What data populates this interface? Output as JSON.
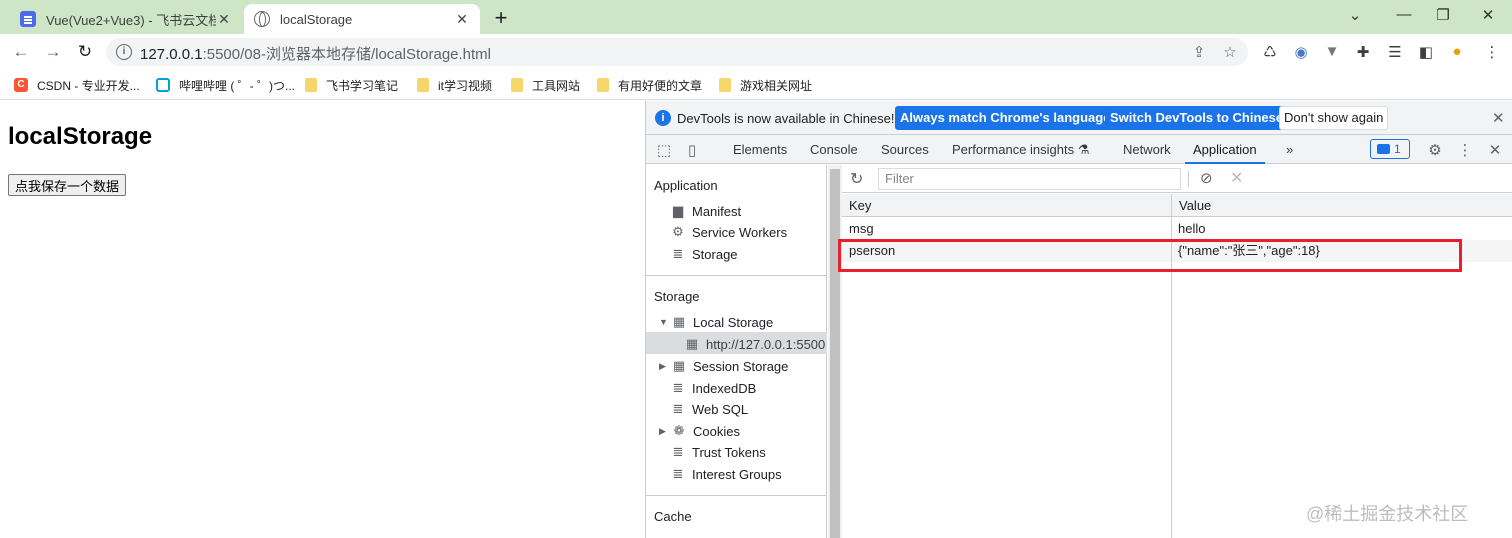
{
  "tabs": [
    {
      "title": "Vue(Vue2+Vue3) - 飞书云文档",
      "close": "✕"
    },
    {
      "title": "localStorage",
      "close": "✕"
    }
  ],
  "newtab": "+",
  "window_controls": {
    "dropdown": "⌄",
    "minimize": "—",
    "maximize": "❐",
    "close": "✕"
  },
  "nav": {
    "back": "←",
    "forward": "→",
    "reload": "↻"
  },
  "omnibox": {
    "host": "127.0.0.1",
    "path": ":5500/08-浏览器本地存储/localStorage.html"
  },
  "bookmarks": [
    {
      "label": "CSDN - 专业开发..."
    },
    {
      "label": "哔哩哔哩 ( ゜- ゜)つ..."
    },
    {
      "label": "飞书学习笔记"
    },
    {
      "label": "it学习视频"
    },
    {
      "label": "工具网站"
    },
    {
      "label": "有用好便的文章"
    },
    {
      "label": "游戏相关网址"
    }
  ],
  "page": {
    "heading": "localStorage",
    "button_label": "点我保存一个数据"
  },
  "devtools": {
    "infobar": {
      "message": "DevTools is now available in Chinese!",
      "btn_match": "Always match Chrome's language",
      "btn_switch": "Switch DevTools to Chinese",
      "btn_dismiss": "Don't show again"
    },
    "tabs": {
      "elements": "Elements",
      "console": "Console",
      "sources": "Sources",
      "performance": "Performance insights",
      "network": "Network",
      "application": "Application",
      "more": "»"
    },
    "issues_count": "1",
    "sidebar": {
      "application_header": "Application",
      "manifest": "Manifest",
      "service_workers": "Service Workers",
      "storage_item": "Storage",
      "storage_header": "Storage",
      "local_storage": "Local Storage",
      "local_storage_origin": "http://127.0.0.1:5500",
      "session_storage": "Session Storage",
      "indexeddb": "IndexedDB",
      "websql": "Web SQL",
      "cookies": "Cookies",
      "trust_tokens": "Trust Tokens",
      "interest_groups": "Interest Groups",
      "cache_header": "Cache"
    },
    "filter_placeholder": "Filter",
    "table": {
      "headers": {
        "key": "Key",
        "value": "Value"
      },
      "rows": [
        {
          "key": "msg",
          "value": "hello"
        },
        {
          "key": "pserson",
          "value": "{\"name\":\"张三\",\"age\":18}"
        }
      ]
    }
  },
  "watermark": "@稀土掘金技术社区"
}
